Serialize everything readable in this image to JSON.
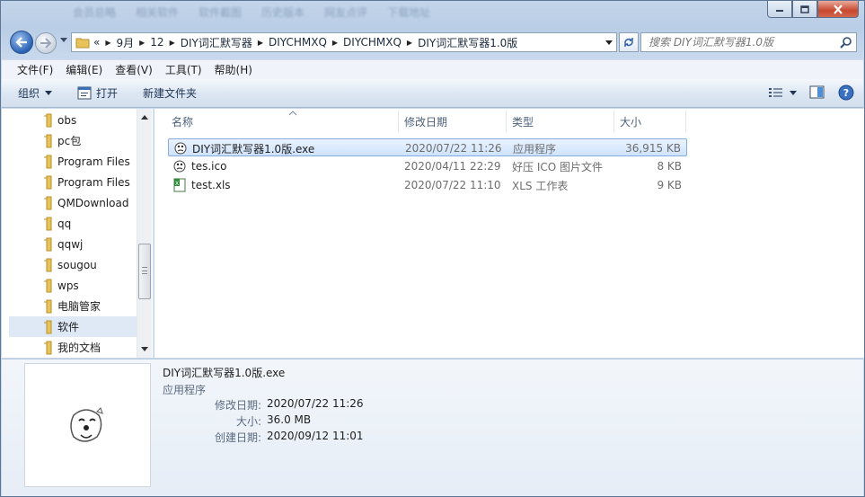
{
  "background_tabs": [
    "会员总略",
    "相关软件",
    "软件截图",
    "历史版本",
    "网友点评",
    "下载地址"
  ],
  "window_controls": {
    "minimize": "minimize",
    "maximize": "maximize",
    "close": "close"
  },
  "address_bar": {
    "crumbs": [
      "«",
      "9月",
      "12",
      "DIY词汇默写器",
      "DIYCHMXQ",
      "DIYCHMXQ",
      "DIY词汇默写器1.0版"
    ]
  },
  "search": {
    "placeholder": "搜索 DIY词汇默写器1.0版"
  },
  "menu": [
    "文件(F)",
    "编辑(E)",
    "查看(V)",
    "工具(T)",
    "帮助(H)"
  ],
  "toolbar": {
    "organize": "组织",
    "open": "打开",
    "new_folder": "新建文件夹"
  },
  "nav_items": [
    {
      "label": "obs"
    },
    {
      "label": "pc包"
    },
    {
      "label": "Program Files"
    },
    {
      "label": "Program Files"
    },
    {
      "label": "QMDownload"
    },
    {
      "label": "qq"
    },
    {
      "label": "qqwj"
    },
    {
      "label": "sougou"
    },
    {
      "label": "wps"
    },
    {
      "label": "电脑管家"
    },
    {
      "label": "软件"
    },
    {
      "label": "我的文档"
    }
  ],
  "columns": {
    "name": "名称",
    "date": "修改日期",
    "type": "类型",
    "size": "大小"
  },
  "files": [
    {
      "name": "DIY词汇默写器1.0版.exe",
      "date": "2020/07/22 11:26",
      "type": "应用程序",
      "size": "36,915 KB",
      "icon": "app-icon"
    },
    {
      "name": "tes.ico",
      "date": "2020/04/11 22:29",
      "type": "好压 ICO 图片文件",
      "size": "8 KB",
      "icon": "ico-file-icon"
    },
    {
      "name": "test.xls",
      "date": "2020/07/22 11:10",
      "type": "XLS 工作表",
      "size": "9 KB",
      "icon": "xls-file-icon"
    }
  ],
  "details": {
    "title": "DIY词汇默写器1.0版.exe",
    "type": "应用程序",
    "modified_label": "修改日期:",
    "modified": "2020/07/22 11:26",
    "size_label": "大小:",
    "size": "36.0 MB",
    "created_label": "创建日期:",
    "created": "2020/09/12 11:01"
  }
}
